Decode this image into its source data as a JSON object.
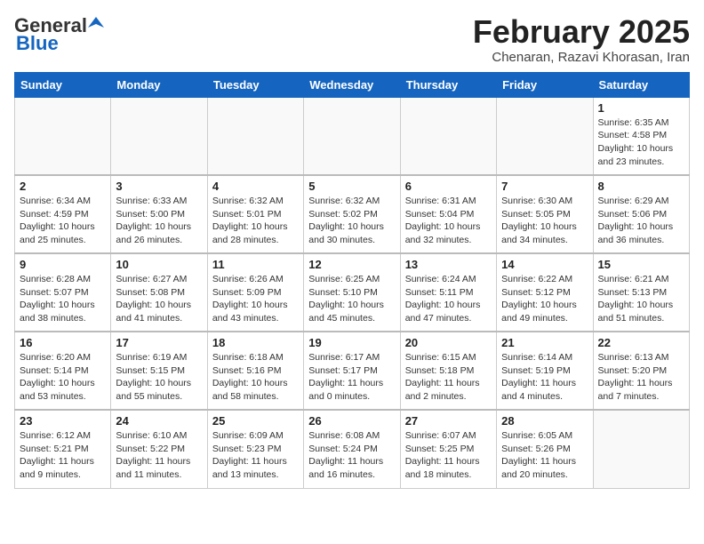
{
  "logo": {
    "general": "General",
    "blue": "Blue"
  },
  "title": "February 2025",
  "subtitle": "Chenaran, Razavi Khorasan, Iran",
  "days": [
    "Sunday",
    "Monday",
    "Tuesday",
    "Wednesday",
    "Thursday",
    "Friday",
    "Saturday"
  ],
  "weeks": [
    [
      {
        "day": "",
        "info": ""
      },
      {
        "day": "",
        "info": ""
      },
      {
        "day": "",
        "info": ""
      },
      {
        "day": "",
        "info": ""
      },
      {
        "day": "",
        "info": ""
      },
      {
        "day": "",
        "info": ""
      },
      {
        "day": "1",
        "info": "Sunrise: 6:35 AM\nSunset: 4:58 PM\nDaylight: 10 hours\nand 23 minutes."
      }
    ],
    [
      {
        "day": "2",
        "info": "Sunrise: 6:34 AM\nSunset: 4:59 PM\nDaylight: 10 hours\nand 25 minutes."
      },
      {
        "day": "3",
        "info": "Sunrise: 6:33 AM\nSunset: 5:00 PM\nDaylight: 10 hours\nand 26 minutes."
      },
      {
        "day": "4",
        "info": "Sunrise: 6:32 AM\nSunset: 5:01 PM\nDaylight: 10 hours\nand 28 minutes."
      },
      {
        "day": "5",
        "info": "Sunrise: 6:32 AM\nSunset: 5:02 PM\nDaylight: 10 hours\nand 30 minutes."
      },
      {
        "day": "6",
        "info": "Sunrise: 6:31 AM\nSunset: 5:04 PM\nDaylight: 10 hours\nand 32 minutes."
      },
      {
        "day": "7",
        "info": "Sunrise: 6:30 AM\nSunset: 5:05 PM\nDaylight: 10 hours\nand 34 minutes."
      },
      {
        "day": "8",
        "info": "Sunrise: 6:29 AM\nSunset: 5:06 PM\nDaylight: 10 hours\nand 36 minutes."
      }
    ],
    [
      {
        "day": "9",
        "info": "Sunrise: 6:28 AM\nSunset: 5:07 PM\nDaylight: 10 hours\nand 38 minutes."
      },
      {
        "day": "10",
        "info": "Sunrise: 6:27 AM\nSunset: 5:08 PM\nDaylight: 10 hours\nand 41 minutes."
      },
      {
        "day": "11",
        "info": "Sunrise: 6:26 AM\nSunset: 5:09 PM\nDaylight: 10 hours\nand 43 minutes."
      },
      {
        "day": "12",
        "info": "Sunrise: 6:25 AM\nSunset: 5:10 PM\nDaylight: 10 hours\nand 45 minutes."
      },
      {
        "day": "13",
        "info": "Sunrise: 6:24 AM\nSunset: 5:11 PM\nDaylight: 10 hours\nand 47 minutes."
      },
      {
        "day": "14",
        "info": "Sunrise: 6:22 AM\nSunset: 5:12 PM\nDaylight: 10 hours\nand 49 minutes."
      },
      {
        "day": "15",
        "info": "Sunrise: 6:21 AM\nSunset: 5:13 PM\nDaylight: 10 hours\nand 51 minutes."
      }
    ],
    [
      {
        "day": "16",
        "info": "Sunrise: 6:20 AM\nSunset: 5:14 PM\nDaylight: 10 hours\nand 53 minutes."
      },
      {
        "day": "17",
        "info": "Sunrise: 6:19 AM\nSunset: 5:15 PM\nDaylight: 10 hours\nand 55 minutes."
      },
      {
        "day": "18",
        "info": "Sunrise: 6:18 AM\nSunset: 5:16 PM\nDaylight: 10 hours\nand 58 minutes."
      },
      {
        "day": "19",
        "info": "Sunrise: 6:17 AM\nSunset: 5:17 PM\nDaylight: 11 hours\nand 0 minutes."
      },
      {
        "day": "20",
        "info": "Sunrise: 6:15 AM\nSunset: 5:18 PM\nDaylight: 11 hours\nand 2 minutes."
      },
      {
        "day": "21",
        "info": "Sunrise: 6:14 AM\nSunset: 5:19 PM\nDaylight: 11 hours\nand 4 minutes."
      },
      {
        "day": "22",
        "info": "Sunrise: 6:13 AM\nSunset: 5:20 PM\nDaylight: 11 hours\nand 7 minutes."
      }
    ],
    [
      {
        "day": "23",
        "info": "Sunrise: 6:12 AM\nSunset: 5:21 PM\nDaylight: 11 hours\nand 9 minutes."
      },
      {
        "day": "24",
        "info": "Sunrise: 6:10 AM\nSunset: 5:22 PM\nDaylight: 11 hours\nand 11 minutes."
      },
      {
        "day": "25",
        "info": "Sunrise: 6:09 AM\nSunset: 5:23 PM\nDaylight: 11 hours\nand 13 minutes."
      },
      {
        "day": "26",
        "info": "Sunrise: 6:08 AM\nSunset: 5:24 PM\nDaylight: 11 hours\nand 16 minutes."
      },
      {
        "day": "27",
        "info": "Sunrise: 6:07 AM\nSunset: 5:25 PM\nDaylight: 11 hours\nand 18 minutes."
      },
      {
        "day": "28",
        "info": "Sunrise: 6:05 AM\nSunset: 5:26 PM\nDaylight: 11 hours\nand 20 minutes."
      },
      {
        "day": "",
        "info": ""
      }
    ]
  ]
}
